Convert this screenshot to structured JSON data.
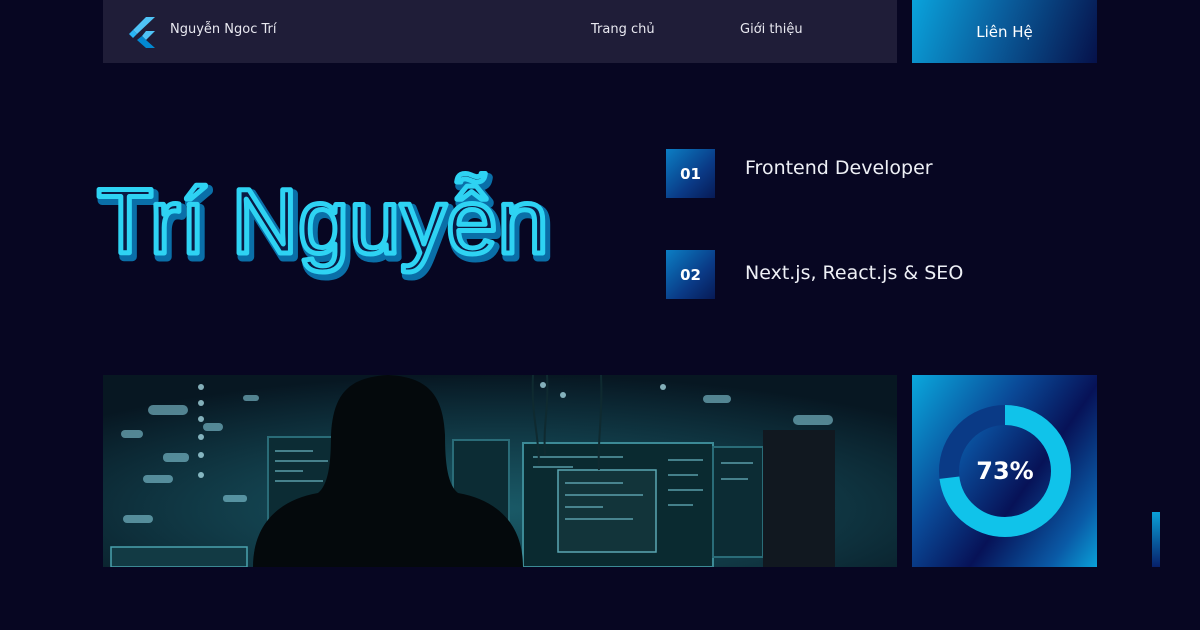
{
  "nav": {
    "brand_name": "Nguyễn Ngoc Trí",
    "links": [
      {
        "label": "Trang chủ"
      },
      {
        "label": "Giới thiệu"
      }
    ],
    "contact_label": "Liên Hệ",
    "logo_icon": "flutter-logo-icon"
  },
  "hero": {
    "name": "Trí Nguyễn",
    "features": [
      {
        "number": "01",
        "text": "Frontend Developer"
      },
      {
        "number": "02",
        "text": "Next.js, React.js & SEO"
      }
    ],
    "image_description_icon": "hacker-at-computers-image"
  },
  "stat": {
    "value_label": "73%",
    "percent": 73
  },
  "colors": {
    "background": "#070622",
    "navbar": "#1f1d38",
    "accent_cyan": "#12c6ec",
    "accent_blue": "#0a4a98"
  }
}
